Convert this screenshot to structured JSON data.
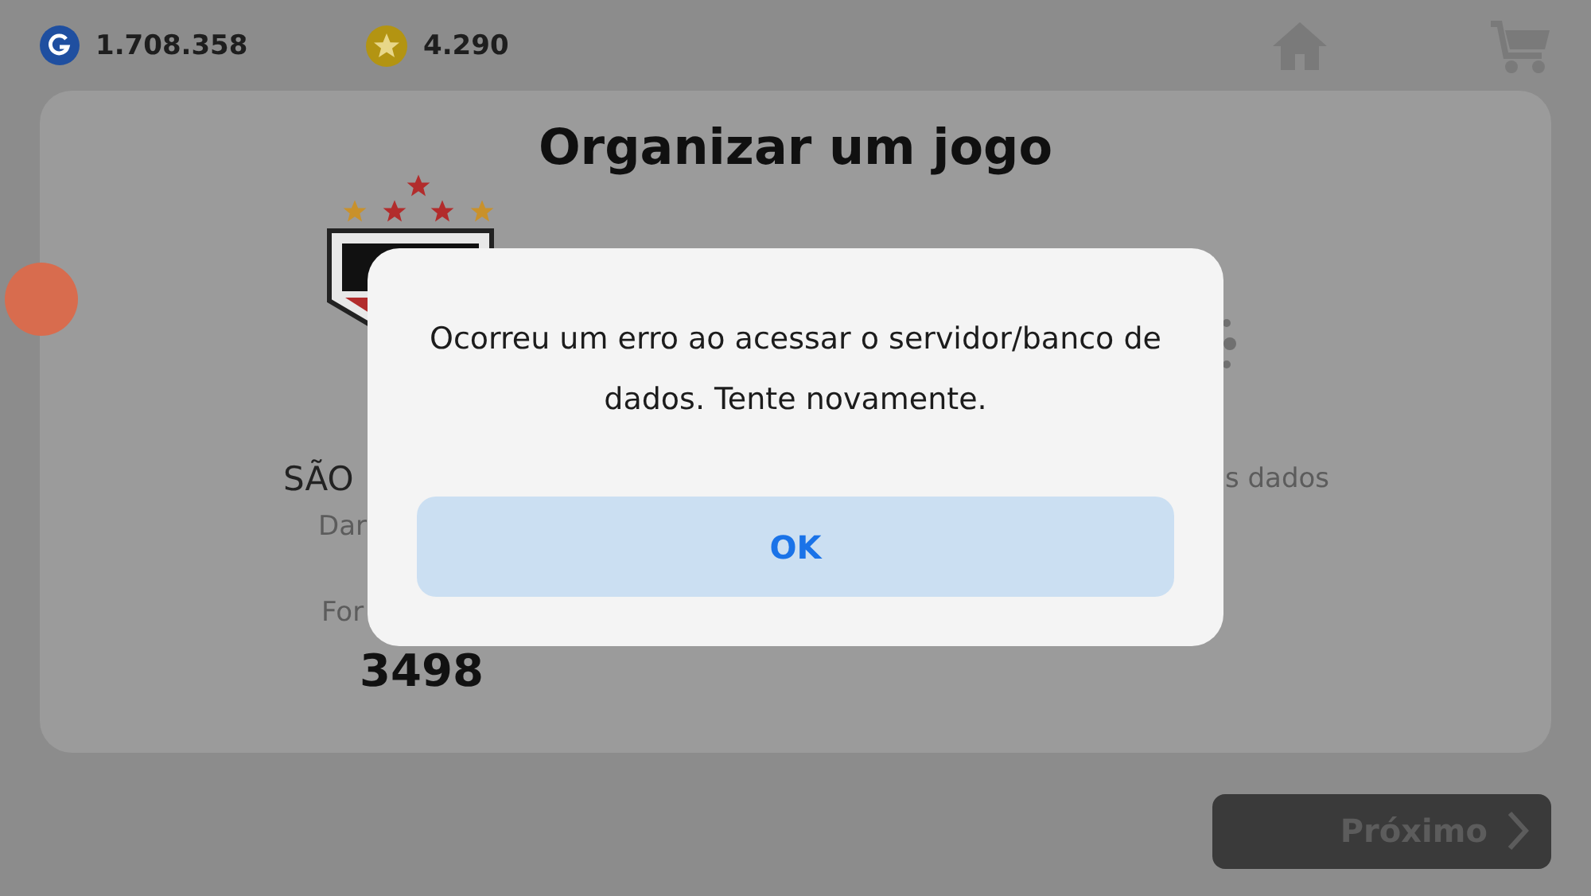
{
  "top_bar": {
    "currencies": [
      {
        "kind": "gp",
        "amount": "1.708.358"
      },
      {
        "kind": "coin",
        "amount": "4.290"
      }
    ]
  },
  "panel": {
    "title": "Organizar um jogo",
    "home_team": {
      "name": "SÃO",
      "subtitle": "Dar",
      "strength_label": "For",
      "strength": "3498"
    },
    "away_team": {
      "subtitle": "s dados"
    }
  },
  "dialog": {
    "message": "Ocorreu um erro ao acessar o servidor/banco de dados. Tente novamente.",
    "button": "OK"
  },
  "next_button": {
    "label": "Próximo",
    "disabled": true
  }
}
